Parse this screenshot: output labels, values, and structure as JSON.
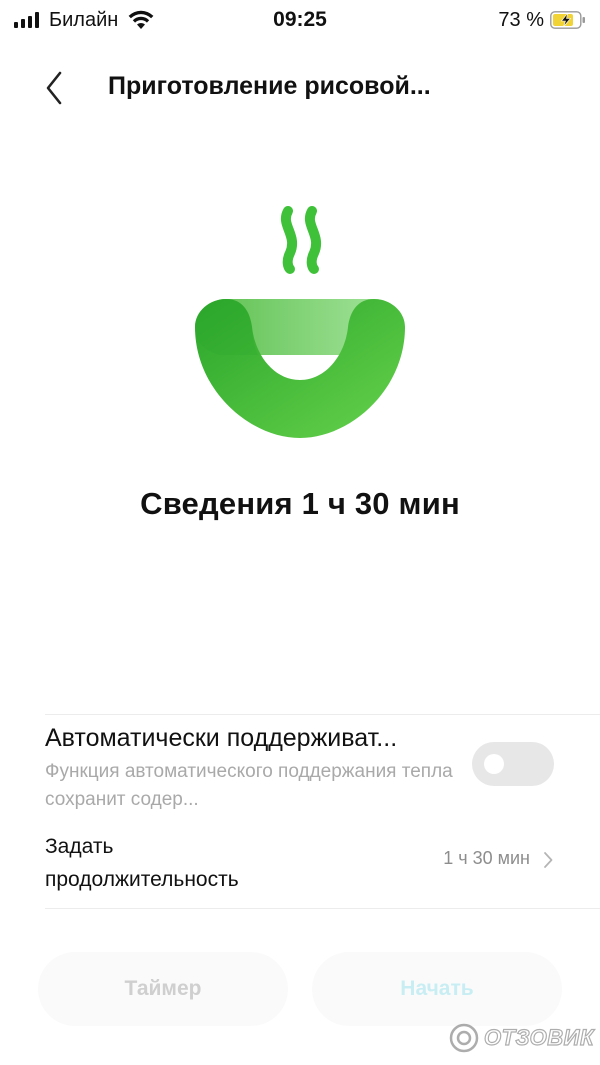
{
  "status_bar": {
    "carrier": "Билайн",
    "time": "09:25",
    "battery_percent": "73 %",
    "icons": [
      "signal-icon",
      "wifi-icon",
      "battery-charging-icon"
    ]
  },
  "nav": {
    "back_icon": "chevron-left-icon",
    "title": "Приготовление рисовой..."
  },
  "hero": {
    "icon": "steaming-bowl-icon",
    "colors": {
      "dark": "#2aa52a",
      "light": "#5fd24a",
      "steam": "#3fc23a"
    }
  },
  "mode": {
    "text": "Сведения 1 ч 30 мин"
  },
  "keep_warm": {
    "title": "Автоматически поддерживат...",
    "description": "Функция автоматического поддержания тепла сохранит содер...",
    "enabled": false
  },
  "duration": {
    "label": "Задать продолжительность",
    "value": "1 ч 30 мин",
    "chevron_icon": "chevron-right-icon"
  },
  "buttons": {
    "timer_label": "Таймер",
    "start_label": "Начать"
  },
  "watermark": {
    "text": "ОТЗОВИК"
  },
  "colors": {
    "accent_green": "#3fbf3a",
    "start_disabled": "#c8eef4",
    "secondary_text": "#a9a9a9"
  }
}
